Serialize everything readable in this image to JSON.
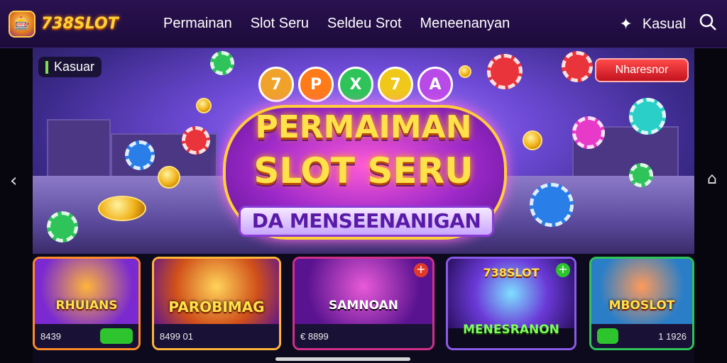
{
  "brand": {
    "name": "738SLOT",
    "logo_icon": "slot-machine-icon"
  },
  "nav": {
    "items": [
      "Permainan",
      "Slot Seru",
      "Seldeu Srot",
      "Meneenanyan"
    ]
  },
  "top_right": {
    "user_icon": "puzzle-user-icon",
    "label": "Kasual",
    "search_icon": "search-icon"
  },
  "hero": {
    "tag": "Kasuar",
    "button": "Nharesnor",
    "title_line1": "PERMAIMAN",
    "title_line2": "SLOT SERU",
    "subtitle": "DA MENSEENANIGAN",
    "orbs": [
      "7",
      "P",
      "X",
      "7",
      "A"
    ]
  },
  "nav_arrows": {
    "left": "‹",
    "right": "⌂"
  },
  "cards": [
    {
      "title": "RHUIANS",
      "meta": "8439",
      "accent": "#ff7a18",
      "has_toggle": true
    },
    {
      "title": "PAROBIMAG",
      "meta": "8499 01",
      "accent": "#ff9f1a",
      "has_toggle": false
    },
    {
      "title": "SAMNOAN",
      "meta": "€ 8899",
      "accent": "#d0308a",
      "has_toggle": false,
      "badge": "+"
    },
    {
      "title": "MENESRANON",
      "meta": "738SLOT",
      "accent": "#6b3ad8",
      "has_toggle": false,
      "badge": "+"
    },
    {
      "title": "MBOSLOT",
      "meta": "1 1926",
      "accent": "#ff5a2a",
      "has_toggle": true
    }
  ]
}
